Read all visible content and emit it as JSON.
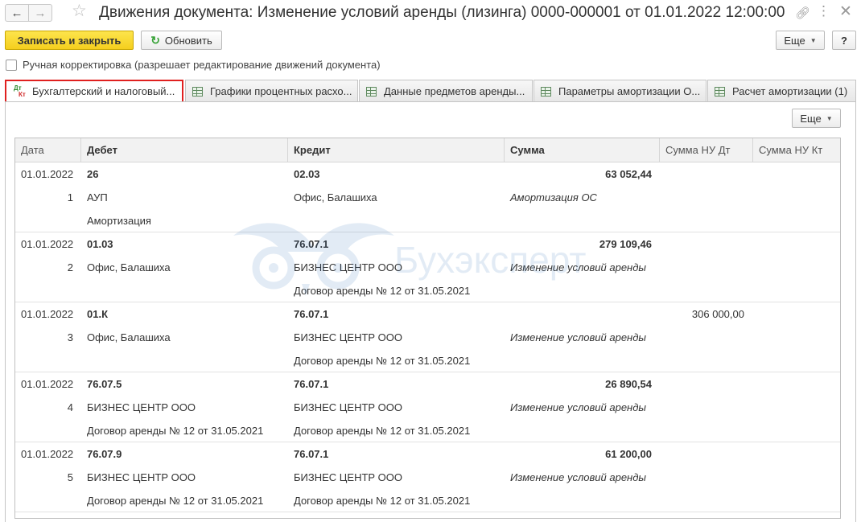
{
  "window": {
    "title": "Движения документа: Изменение условий аренды (лизинга) 0000-000001 от 01.01.2022 12:00:00"
  },
  "toolbar": {
    "save_close": "Записать и закрыть",
    "refresh": "Обновить",
    "more": "Еще",
    "help": "?"
  },
  "manual_edit": {
    "label": "Ручная корректировка (разрешает редактирование движений документа)",
    "checked": false
  },
  "tabs": [
    {
      "label": "Бухгалтерский и налоговый...",
      "icon": "dt-kt-icon",
      "active": true
    },
    {
      "label": "Графики процентных расхо...",
      "icon": "table-icon",
      "active": false
    },
    {
      "label": "Данные предметов аренды...",
      "icon": "table-icon",
      "active": false
    },
    {
      "label": "Параметры амортизации О...",
      "icon": "table-icon",
      "active": false
    },
    {
      "label": "Расчет амортизации (1)",
      "icon": "table-icon",
      "active": false
    }
  ],
  "panel": {
    "more": "Еще"
  },
  "watermark": {
    "text": "Бухэксперт"
  },
  "table": {
    "columns": [
      "Дата",
      "Дебет",
      "Кредит",
      "Сумма",
      "Сумма НУ Дт",
      "Сумма НУ Кт"
    ],
    "rows": [
      {
        "date": "01.01.2022",
        "num": "1",
        "debit": [
          "26",
          "АУП",
          "Амортизация"
        ],
        "credit": [
          "02.03",
          "Офис, Балашиха",
          ""
        ],
        "sum": "63 052,44",
        "content": "Амортизация ОС",
        "nu_dt": "",
        "nu_kt": ""
      },
      {
        "date": "01.01.2022",
        "num": "2",
        "debit": [
          "01.03",
          "Офис, Балашиха",
          ""
        ],
        "credit": [
          "76.07.1",
          "БИЗНЕС ЦЕНТР ООО",
          "Договор аренды № 12 от 31.05.2021"
        ],
        "sum": "279 109,46",
        "content": "Изменение условий аренды",
        "nu_dt": "",
        "nu_kt": ""
      },
      {
        "date": "01.01.2022",
        "num": "3",
        "debit": [
          "01.К",
          "Офис, Балашиха",
          ""
        ],
        "credit": [
          "76.07.1",
          "БИЗНЕС ЦЕНТР ООО",
          "Договор аренды № 12 от 31.05.2021"
        ],
        "sum": "",
        "content": "Изменение условий аренды",
        "nu_dt": "306 000,00",
        "nu_kt": ""
      },
      {
        "date": "01.01.2022",
        "num": "4",
        "debit": [
          "76.07.5",
          "БИЗНЕС ЦЕНТР ООО",
          "Договор аренды № 12 от 31.05.2021"
        ],
        "credit": [
          "76.07.1",
          "БИЗНЕС ЦЕНТР ООО",
          "Договор аренды № 12 от 31.05.2021"
        ],
        "sum": "26 890,54",
        "content": "Изменение условий аренды",
        "nu_dt": "",
        "nu_kt": ""
      },
      {
        "date": "01.01.2022",
        "num": "5",
        "debit": [
          "76.07.9",
          "БИЗНЕС ЦЕНТР ООО",
          "Договор аренды № 12 от 31.05.2021"
        ],
        "credit": [
          "76.07.1",
          "БИЗНЕС ЦЕНТР ООО",
          "Договор аренды № 12 от 31.05.2021"
        ],
        "sum": "61 200,00",
        "content": "Изменение условий аренды",
        "nu_dt": "",
        "nu_kt": ""
      }
    ]
  }
}
